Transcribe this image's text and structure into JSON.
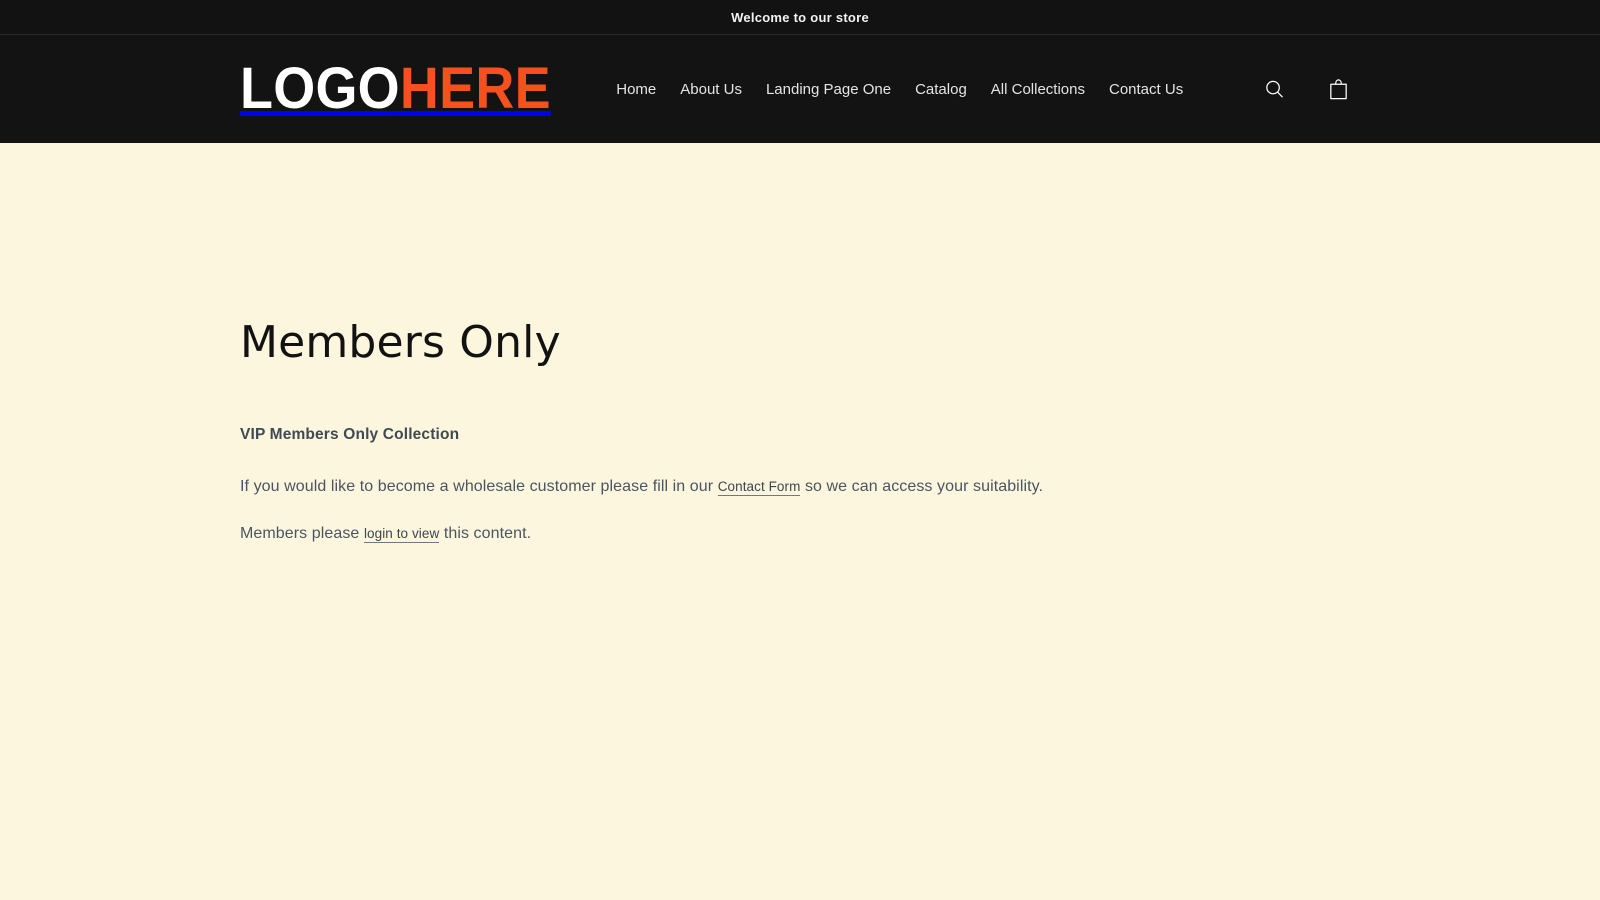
{
  "announcement": {
    "text": "Welcome to our store"
  },
  "header": {
    "logo": {
      "part_a": "LOGO",
      "part_b": "HERE",
      "color_a": "#FFFFFF",
      "color_b": "#F4511E"
    },
    "nav": [
      {
        "label": "Home"
      },
      {
        "label": "About Us"
      },
      {
        "label": "Landing Page One"
      },
      {
        "label": "Catalog"
      },
      {
        "label": "All Collections"
      },
      {
        "label": "Contact Us"
      }
    ],
    "actions": {
      "search_label": "search-icon",
      "cart_label": "cart-icon"
    },
    "background": "#131313"
  },
  "main": {
    "title": "Members Only",
    "body": {
      "subheading": "VIP Members Only Collection",
      "paragraph_1": {
        "before_link": "If you would like to become a wholesale customer please fill in our",
        "link": "Contact Form",
        "after_link": "so we can access your suitability."
      },
      "paragraph_2": {
        "before_link": "Members please",
        "link": "login to view",
        "after_link": "this content."
      }
    },
    "background": "#FDF6DE"
  }
}
